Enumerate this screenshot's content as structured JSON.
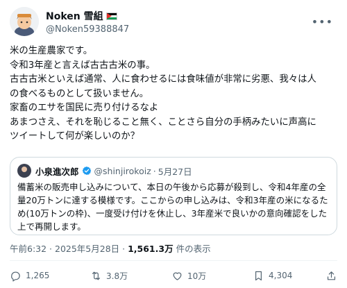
{
  "author": {
    "name": "Noken 雪組",
    "handle": "@Noken59388847"
  },
  "tweet": {
    "lines": [
      "米の生産農家です。",
      "令和3年産と言えば古古古米の事。",
      "古古古米といえば通常、人に食わせるには食味値が非常に劣悪、我々は人",
      "の食べるものとして扱いません。",
      "家畜のエサを国民に売り付けるなよ",
      "あまつさえ、それを恥じること無く、ことさら自分の手柄みたいに声高に",
      "ツイートして何が楽しいのか？"
    ]
  },
  "quote": {
    "name": "小泉進次郎",
    "handle": "@shinjirokoiz",
    "dot": "·",
    "date": "5月27日",
    "lines": [
      "備蓄米の販売申し込みについて、本日の午後から応募が殺到し、令和4年産の全",
      "量20万トンに達する模様です。ここからの申し込みは、令和3年産の米になるた",
      "め(10万トンの枠)、一度受け付けを休止し、3年産米で良いかの意向確認をした",
      "上で再開します。"
    ]
  },
  "meta": {
    "timestamp": "午前6:32 · 2025年5月28日 · ",
    "views": "1,561.3万",
    "views_suffix": " 件の表示"
  },
  "actions": {
    "replies": "1,265",
    "reposts": "3.8万",
    "likes": "10万",
    "bookmarks": "4,304"
  },
  "colors": {
    "text": "#0f1419",
    "secondary": "#536471",
    "verified": "#1d9bf0",
    "border": "#cfd9de"
  }
}
